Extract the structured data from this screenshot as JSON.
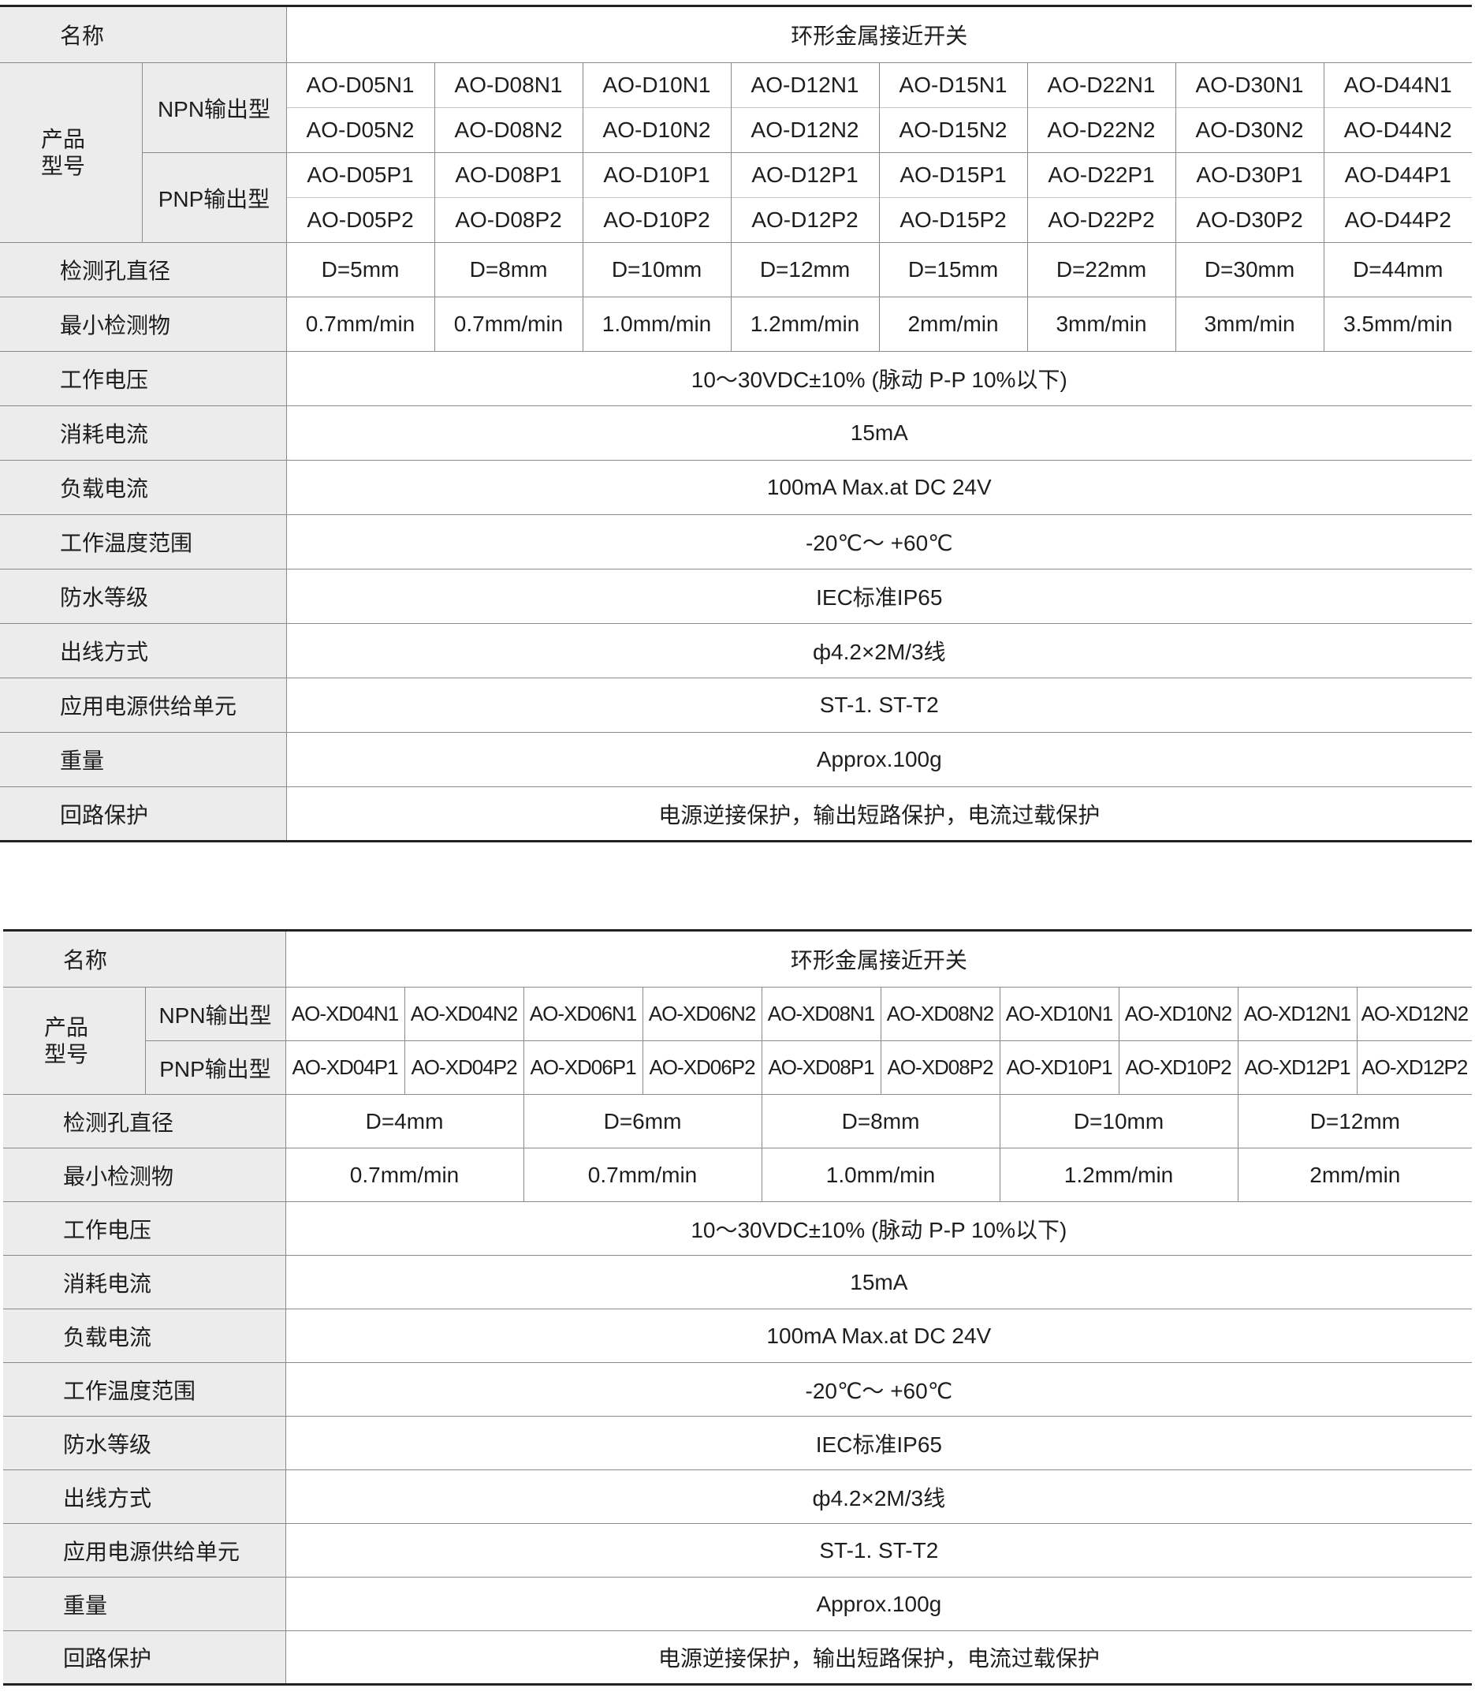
{
  "table1": {
    "name_label": "名称",
    "title": "环形金属接近开关",
    "model_label": [
      "产品",
      "型号"
    ],
    "npn_label": "NPN输出型",
    "pnp_label": "PNP输出型",
    "npn_1": [
      "AO-D05N1",
      "AO-D08N1",
      "AO-D10N1",
      "AO-D12N1",
      "AO-D15N1",
      "AO-D22N1",
      "AO-D30N1",
      "AO-D44N1"
    ],
    "npn_2": [
      "AO-D05N2",
      "AO-D08N2",
      "AO-D10N2",
      "AO-D12N2",
      "AO-D15N2",
      "AO-D22N2",
      "AO-D30N2",
      "AO-D44N2"
    ],
    "pnp_1": [
      "AO-D05P1",
      "AO-D08P1",
      "AO-D10P1",
      "AO-D12P1",
      "AO-D15P1",
      "AO-D22P1",
      "AO-D30P1",
      "AO-D44P1"
    ],
    "pnp_2": [
      "AO-D05P2",
      "AO-D08P2",
      "AO-D10P2",
      "AO-D12P2",
      "AO-D15P2",
      "AO-D22P2",
      "AO-D30P2",
      "AO-D44P2"
    ],
    "diameter_label": "检测孔直径",
    "diameter": [
      "D=5mm",
      "D=8mm",
      "D=10mm",
      "D=12mm",
      "D=15mm",
      "D=22mm",
      "D=30mm",
      "D=44mm"
    ],
    "min_object_label": "最小检测物",
    "min_object": [
      "0.7mm/min",
      "0.7mm/min",
      "1.0mm/min",
      "1.2mm/min",
      "2mm/min",
      "3mm/min",
      "3mm/min",
      "3.5mm/min"
    ],
    "specs": [
      {
        "label": "工作电压",
        "value": "10～30VDC±10% (脉动 P-P 10%以下)"
      },
      {
        "label": "消耗电流",
        "value": "15mA"
      },
      {
        "label": "负载电流",
        "value": "100mA Max.at  DC 24V"
      },
      {
        "label": "工作温度范围",
        "value": "-20℃～ +60℃"
      },
      {
        "label": "防水等级",
        "value": "IEC标准IP65"
      },
      {
        "label": "出线方式",
        "value": "ф4.2×2M/3线"
      },
      {
        "label": "应用电源供给单元",
        "value": "ST-1. ST-T2"
      },
      {
        "label": "重量",
        "value": "Approx.100g"
      },
      {
        "label": "回路保护",
        "value": "电源逆接保护，输出短路保护，电流过载保护"
      }
    ]
  },
  "table2": {
    "name_label": "名称",
    "title": "环形金属接近开关",
    "model_label": [
      "产品",
      "型号"
    ],
    "npn_label": "NPN输出型",
    "pnp_label": "PNP输出型",
    "npn": [
      "AO-XD04N1",
      "AO-XD04N2",
      "AO-XD06N1",
      "AO-XD06N2",
      "AO-XD08N1",
      "AO-XD08N2",
      "AO-XD10N1",
      "AO-XD10N2",
      "AO-XD12N1",
      "AO-XD12N2"
    ],
    "pnp": [
      "AO-XD04P1",
      "AO-XD04P2",
      "AO-XD06P1",
      "AO-XD06P2",
      "AO-XD08P1",
      "AO-XD08P2",
      "AO-XD10P1",
      "AO-XD10P2",
      "AO-XD12P1",
      "AO-XD12P2"
    ],
    "diameter_label": "检测孔直径",
    "diameter": [
      "D=4mm",
      "D=6mm",
      "D=8mm",
      "D=10mm",
      "D=12mm"
    ],
    "min_object_label": "最小检测物",
    "min_object": [
      "0.7mm/min",
      "0.7mm/min",
      "1.0mm/min",
      "1.2mm/min",
      "2mm/min"
    ],
    "specs": [
      {
        "label": "工作电压",
        "value": "10～30VDC±10% (脉动 P-P 10%以下)"
      },
      {
        "label": "消耗电流",
        "value": "15mA"
      },
      {
        "label": "负载电流",
        "value": "100mA Max.at  DC 24V"
      },
      {
        "label": "工作温度范围",
        "value": "-20℃～ +60℃"
      },
      {
        "label": "防水等级",
        "value": "IEC标准IP65"
      },
      {
        "label": "出线方式",
        "value": "ф4.2×2M/3线"
      },
      {
        "label": "应用电源供给单元",
        "value": "ST-1. ST-T2"
      },
      {
        "label": "重量",
        "value": "Approx.100g"
      },
      {
        "label": "回路保护",
        "value": "电源逆接保护，输出短路保护，电流过载保护"
      }
    ]
  }
}
